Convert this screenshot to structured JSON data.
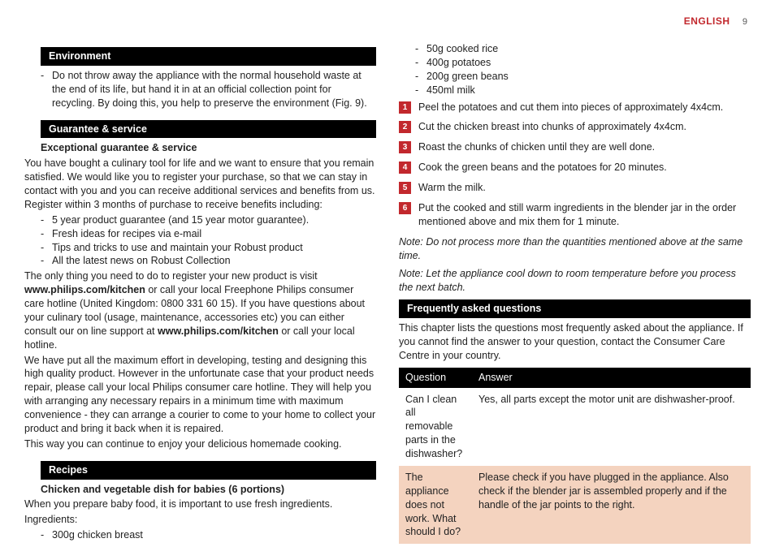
{
  "header": {
    "language": "ENGLISH",
    "page_number": "9"
  },
  "left": {
    "env": {
      "heading": "Environment",
      "bullet": "Do not throw away the appliance with the normal household waste at the end of its life, but hand it in at an official collection point for recycling. By doing this, you help to preserve the environment (Fig. 9)."
    },
    "guarantee": {
      "heading": "Guarantee & service",
      "subheading": "Exceptional guarantee & service",
      "p1": "You have bought a culinary tool for life and we want to ensure that you remain satisfied. We would like you to register your purchase, so that we can stay in contact with you and you can receive additional services and benefits from us. Register within 3 months of purchase to receive benefits including:",
      "bullets": [
        "5 year product guarantee (and 15 year motor guarantee).",
        "Fresh ideas for recipes via e-mail",
        "Tips and tricks to use and maintain your Robust product",
        "All the latest news on Robust Collection"
      ],
      "p2a": "The only thing you need to do to register your new product is visit ",
      "p2_link1": "www.philips.com/kitchen",
      "p2b": " or call your local Freephone Philips consumer care hotline (United Kingdom: 0800 331 60 15). If you have questions about your culinary tool (usage, maintenance, accessories etc) you can either consult our on line support at ",
      "p2_link2": "www.philips.com/kitchen",
      "p2c": " or call your local hotline.",
      "p3": "We have put all the maximum effort in developing, testing and designing this high quality product. However in the unfortunate case that your product needs repair, please call your local Philips consumer care hotline. They will help you with arranging any necessary repairs in a minimum time with maximum convenience - they can arrange a courier to come to your home to collect your product and bring it back when it is repaired.",
      "p4": "This way you can continue to enjoy your delicious homemade cooking."
    },
    "recipes": {
      "heading": "Recipes",
      "subheading": "Chicken and vegetable dish for babies (6 portions)",
      "p1": "When you prepare baby food, it is important to use fresh ingredients.",
      "p2": "Ingredients:",
      "ing_first": "300g chicken breast"
    }
  },
  "right": {
    "ing_rest": [
      "50g cooked rice",
      "400g potatoes",
      "200g green beans",
      "450ml milk"
    ],
    "steps": [
      "Peel the potatoes and cut them into pieces of approximately 4x4cm.",
      "Cut the chicken breast into chunks of approximately 4x4cm.",
      "Roast the chunks of chicken until they are well done.",
      "Cook the green beans and the potatoes for 20 minutes.",
      "Warm the milk.",
      "Put the cooked and still warm ingredients in the blender jar in the order mentioned above and mix them for 1 minute."
    ],
    "note1": "Note: Do not process more than the quantities mentioned above at the same time.",
    "note2": "Note: Let the appliance cool down to room temperature before you process the next batch.",
    "faq": {
      "heading": "Frequently asked questions",
      "intro": "This chapter lists the questions most frequently asked about the appliance. If you cannot find the answer to your question, contact the Consumer Care Centre in your country.",
      "col_q": "Question",
      "col_a": "Answer",
      "rows": [
        {
          "q": "Can I clean all removable parts in the dishwasher?",
          "a": "Yes, all parts except the motor unit are dishwasher-proof."
        },
        {
          "q": "The appliance does not work. What should I do?",
          "a": "Please check if you have plugged in the appliance. Also check if the blender jar is assembled properly and if the handle of the jar points to the right."
        }
      ]
    }
  }
}
